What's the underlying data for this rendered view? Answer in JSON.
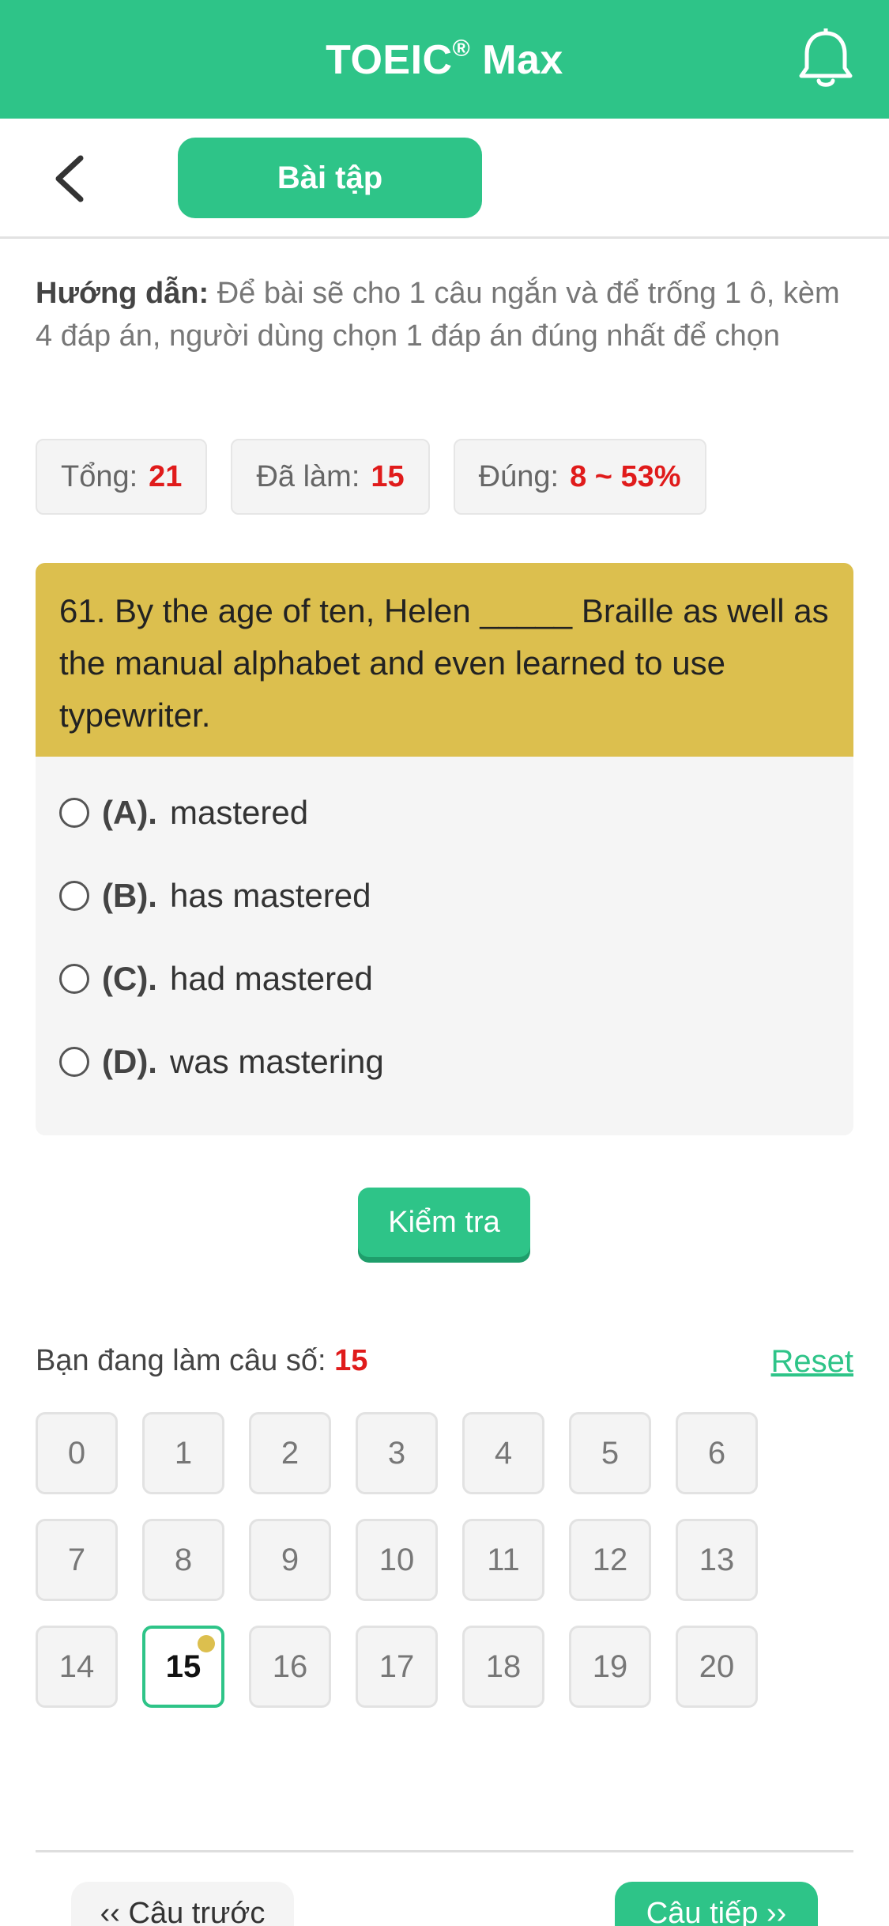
{
  "header": {
    "title": "TOEIC",
    "title_mark": "®",
    "title_suffix": "Max"
  },
  "subnav": {
    "tab_label": "Bài tập"
  },
  "instruction": {
    "label": "Hướng dẫn:",
    "text": "Để bài sẽ cho 1 câu ngắn và để trống 1 ô, kèm 4 đáp án, người dùng chọn 1 đáp án đúng nhất để chọn"
  },
  "stats": [
    {
      "label": "Tổng:",
      "value": "21"
    },
    {
      "label": "Đã làm:",
      "value": "15"
    },
    {
      "label": "Đúng:",
      "value": "8 ~ 53%"
    }
  ],
  "question": {
    "text": "61. By the age of ten, Helen _____ Braille as well as the manual alphabet and even learned to use typewriter.",
    "options": [
      {
        "letter": "(A).",
        "text": "mastered"
      },
      {
        "letter": "(B).",
        "text": "has mastered"
      },
      {
        "letter": "(C).",
        "text": "had mastered"
      },
      {
        "letter": "(D).",
        "text": "was mastering"
      }
    ]
  },
  "check_label": "Kiểm tra",
  "progress": {
    "label": "Bạn đang làm câu số:",
    "current": "15",
    "reset_label": "Reset"
  },
  "grid": [
    "0",
    "1",
    "2",
    "3",
    "4",
    "5",
    "6",
    "7",
    "8",
    "9",
    "10",
    "11",
    "12",
    "13",
    "14",
    "15",
    "16",
    "17",
    "18",
    "19",
    "20"
  ],
  "nav": {
    "prev_label": "‹‹ Câu trước",
    "next_label": "Câu tiếp ››"
  },
  "colors": {
    "brand": "#2ec488",
    "question_bg": "#dcbf4e",
    "highlight": "#e01b1b"
  }
}
